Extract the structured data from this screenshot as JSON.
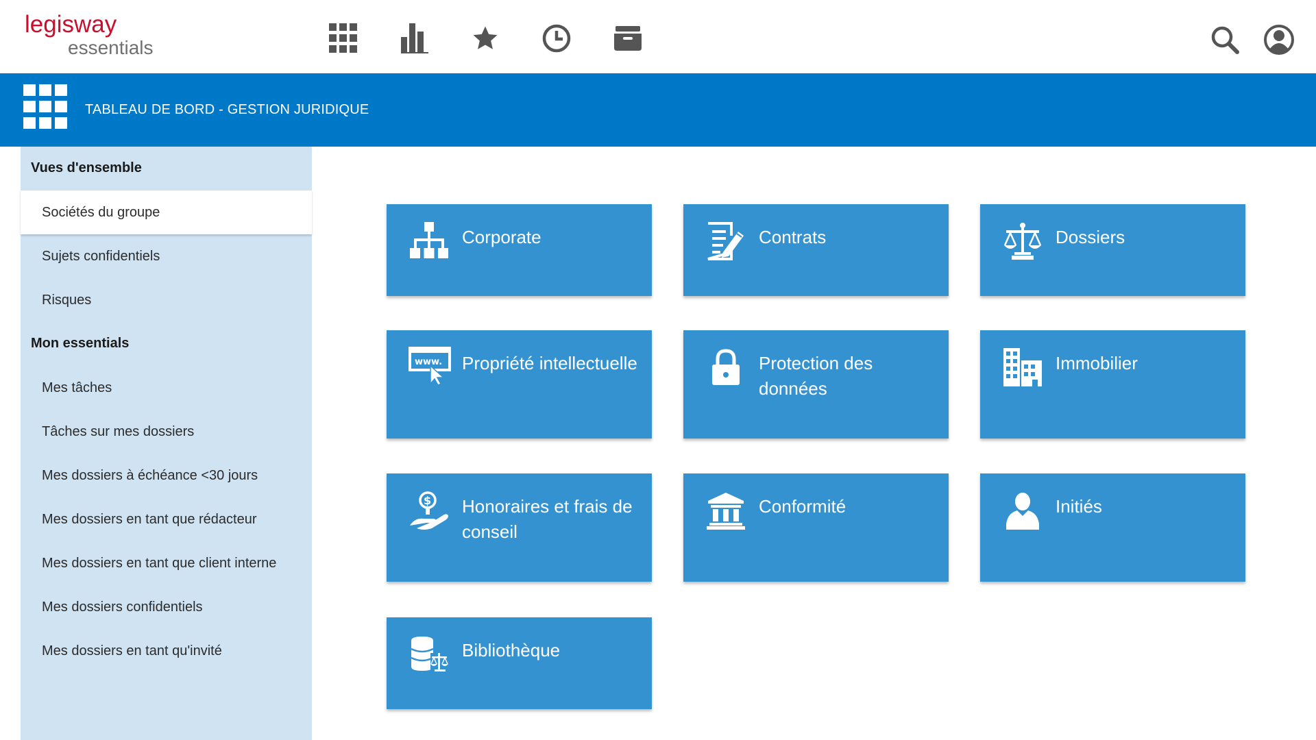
{
  "brand": {
    "name": "legisway",
    "sub": "essentials",
    "color": "#c8102e"
  },
  "topnav": {
    "icons": [
      "apps-grid-icon",
      "bar-chart-icon",
      "star-icon",
      "clock-icon",
      "archive-icon"
    ],
    "right_icons": [
      "search-icon",
      "user-account-icon"
    ]
  },
  "header": {
    "title": "TABLEAU DE BORD - GESTION JURIDIQUE",
    "icon": "apps-grid-icon",
    "bg": "#0078c8"
  },
  "sidebar": {
    "bg": "#d0e3f2",
    "sections": [
      {
        "title": "Vues d'ensemble",
        "items": [
          "Sociétés du groupe",
          "Sujets confidentiels",
          "Risques"
        ]
      },
      {
        "title": "Mon essentials",
        "items": [
          "Mes tâches",
          "Tâches sur mes dossiers",
          "Mes dossiers à échéance <30 jours",
          "Mes dossiers en tant que rédacteur",
          "Mes dossiers en tant que client interne",
          "Mes dossiers confidentiels",
          "Mes dossiers en tant qu'invité"
        ]
      }
    ],
    "active_item": "Sociétés du groupe"
  },
  "tiles": {
    "color": "#3592d1",
    "items": [
      {
        "label": "Corporate",
        "icon": "org-chart-icon"
      },
      {
        "label": "Contrats",
        "icon": "contract-edit-icon"
      },
      {
        "label": "Dossiers",
        "icon": "scales-icon"
      },
      {
        "label": "Propriété intellectuelle",
        "icon": "www-cursor-icon"
      },
      {
        "label": "Protection des données",
        "icon": "padlock-icon"
      },
      {
        "label": "Immobilier",
        "icon": "buildings-icon"
      },
      {
        "label": "Honoraires et frais de conseil",
        "icon": "hand-coin-icon"
      },
      {
        "label": "Conformité",
        "icon": "institution-icon"
      },
      {
        "label": "Initiés",
        "icon": "person-icon"
      },
      {
        "label": "Bibliothèque",
        "icon": "database-scales-icon"
      }
    ]
  }
}
